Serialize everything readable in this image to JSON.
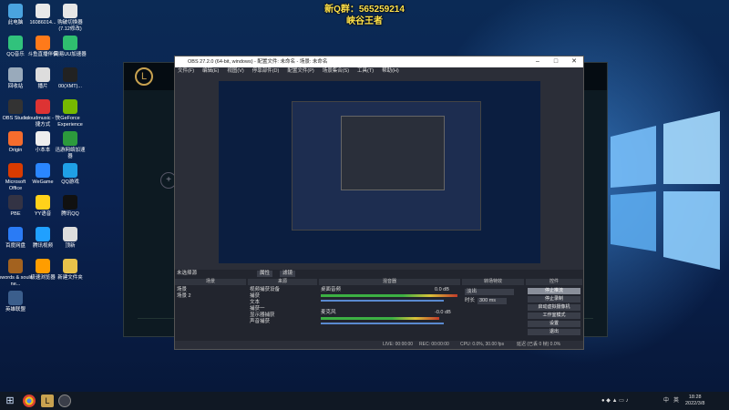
{
  "overlay": {
    "line1": "新Q群：565259214",
    "line2": "峡谷王者"
  },
  "desktop_icons": [
    {
      "label": "此电脑",
      "color": "#4aa3df"
    },
    {
      "label": "16086014...",
      "color": "#e8e8e8"
    },
    {
      "label": "购破切换器\n(7.12修改)",
      "color": "#e6e6e6"
    },
    {
      "label": "QQ音乐",
      "color": "#31c27c"
    },
    {
      "label": "斗鱼直播伴侣",
      "color": "#ff7a1a"
    },
    {
      "label": "网易UU加速器",
      "color": "#2fbf6f"
    },
    {
      "label": "回收站",
      "color": "#9ab"
    },
    {
      "label": "播片",
      "color": "#ddd"
    },
    {
      "label": "00(XMT)...",
      "color": "#222"
    },
    {
      "label": "OBS Studio",
      "color": "#333"
    },
    {
      "label": "cloudmusic - 快捷方式",
      "color": "#d33"
    },
    {
      "label": "GeForce Experience",
      "color": "#76b900"
    },
    {
      "label": "Origin",
      "color": "#f56c2d"
    },
    {
      "label": "小本本",
      "color": "#eee"
    },
    {
      "label": "迅游网络加速器",
      "color": "#2c9a3c"
    },
    {
      "label": "Microsoft Office",
      "color": "#d83b01"
    },
    {
      "label": "WeGame",
      "color": "#2a86ff"
    },
    {
      "label": "QQ游戏",
      "color": "#1fa0e6"
    },
    {
      "label": "PBE",
      "color": "#334"
    },
    {
      "label": "YY语音",
      "color": "#ffd21a"
    },
    {
      "label": "腾讯QQ",
      "color": "#111"
    },
    {
      "label": "百度网盘",
      "color": "#2a7bf5"
    },
    {
      "label": "腾讯视频",
      "color": "#20a0ff"
    },
    {
      "label": "顶新",
      "color": "#ddd"
    },
    {
      "label": "swords & souls ne...",
      "color": "#a3621f"
    },
    {
      "label": "极速浏览器",
      "color": "#ff9d00"
    },
    {
      "label": "新建文件夹",
      "color": "#e9c24a"
    },
    {
      "label": "英雄联盟",
      "color": "#3b5e8c"
    }
  ],
  "obs": {
    "title": "OBS 27.2.0 (64-bit, windows) - 配置文件: 未命名 - 场景: 未命名",
    "menu": [
      "文件(F)",
      "编辑(E)",
      "视图(V)",
      "停靠部件(D)",
      "配置文件(P)",
      "场景集合(S)",
      "工具(T)",
      "帮助(H)"
    ],
    "no_source": "未选择源",
    "props_btn": "属性",
    "filters_btn": "滤镜",
    "panels": {
      "scenes": "场景",
      "sources": "来源",
      "mixer": "混音器",
      "transitions": "转场特效",
      "controls": "控件"
    },
    "scenes": [
      "场景",
      "场景 2"
    ],
    "sources": [
      "视频捕获设备",
      "捕获",
      "文本",
      "捕获一",
      "显示器捕获",
      "声音捕获"
    ],
    "mixer": [
      {
        "name": "桌面音频",
        "db": "0.0 dB"
      },
      {
        "name": "麦克风",
        "db": "-0.0 dB"
      }
    ],
    "transition": {
      "type": "淡出",
      "duration_label": "时长",
      "duration": "300 ms"
    },
    "controls": [
      "停止推流",
      "停止录制",
      "启动虚拟摄像机",
      "工作室模式",
      "设置",
      "退出"
    ],
    "status": {
      "live": "LIVE: 00:00:00",
      "rec": "REC: 00:00:00",
      "cpu": "CPU: 0.0%, 30.00 fps",
      "dropped": "延迟 (已丢 0 帧) 0.0%"
    }
  },
  "taskbar": {
    "time": "18:28",
    "date": "2022/3/8",
    "ime": "中",
    "lang": "英"
  }
}
